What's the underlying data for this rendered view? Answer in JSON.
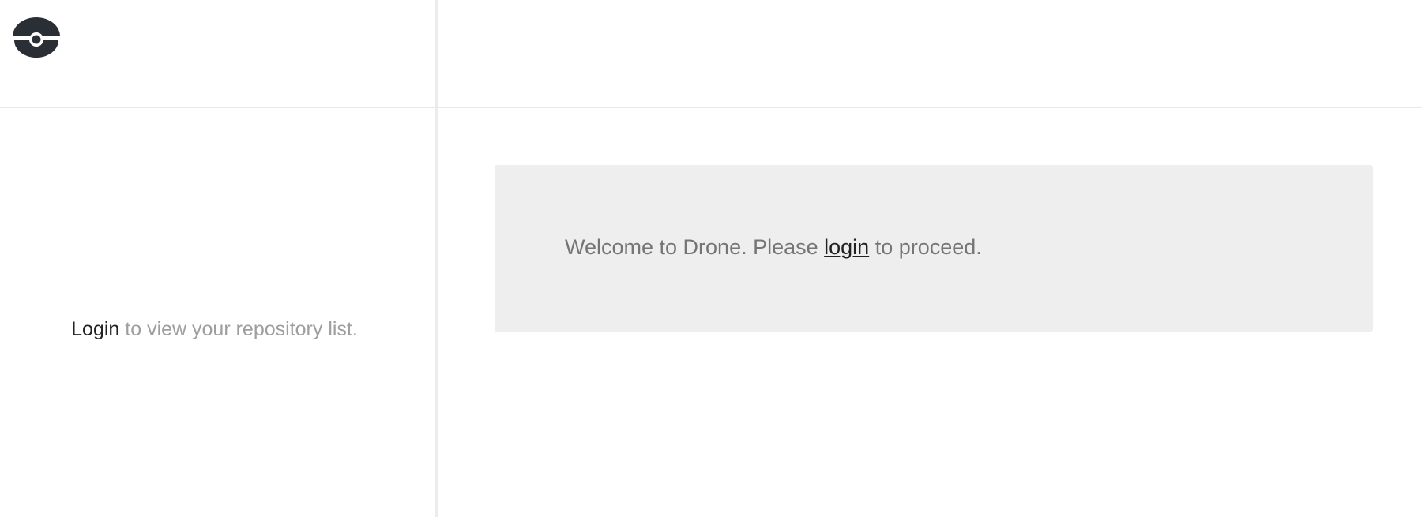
{
  "app": {
    "logo_icon": "drone-logo-icon",
    "logo_color": "#2a2f36"
  },
  "sidebar": {
    "login_link": "Login",
    "message_suffix": " to view your repository list."
  },
  "main": {
    "welcome_prefix": "Welcome to Drone. Please ",
    "login_link": "login",
    "welcome_suffix": " to proceed."
  },
  "colors": {
    "background": "#ffffff",
    "panel": "#eeeeee",
    "divider": "#e8e8e8",
    "text_dark": "#212121",
    "text_muted": "#9e9e9e",
    "text_welcome": "#757575"
  }
}
